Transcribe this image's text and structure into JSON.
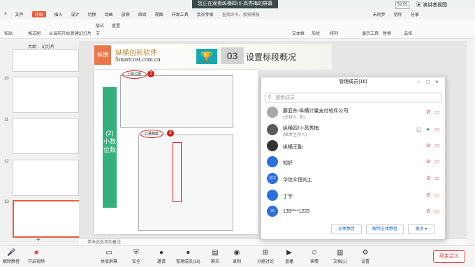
{
  "share_banner": "您正在观看纵横四川-高秀梅的屏幕",
  "clock": "59:55",
  "presenter_label": "演讲者视图",
  "menu": {
    "file": "文件",
    "items": [
      "开始",
      "插入",
      "设计",
      "切换",
      "动画",
      "放映",
      "审阅",
      "视图",
      "开发工具",
      "会员专享"
    ],
    "search": "查找命令、搜索模板",
    "right": [
      "未同步",
      "协作",
      "分享"
    ]
  },
  "ribbon": {
    "paste": "粘贴",
    "format": "格式刷",
    "from_start": "从当前开始",
    "new_slide": "新建幻灯片",
    "layout": "版式",
    "section": "节",
    "reset": "重置",
    "textbox": "文本框",
    "shape": "形状",
    "arrange": "排列",
    "tools": "演示工具",
    "replace": "替换",
    "select": "选择"
  },
  "thumbs_tabs": {
    "outline": "大纲",
    "slides": "幻灯片"
  },
  "thumb_numbers": [
    "10",
    "11",
    "12",
    "13"
  ],
  "slide": {
    "logo": "纵横",
    "brand": "纵横创新软件",
    "url": "Smartcost.com.cn",
    "section_num": "03",
    "section_title": "设置标段概况",
    "side_label": "(2) 小数位数",
    "oval1": "小数位数",
    "oval2": "计量精度",
    "badge1": "1",
    "badge2": "2"
  },
  "notes": "单击此处添加备注",
  "panel": {
    "title": "管理成员(16)",
    "search_placeholder": "搜索成员",
    "members": [
      {
        "name": "藤亚东-纵横计量支付软件公司",
        "role": "(主持人, 我)",
        "avatar": "",
        "avatar_color": "#a7a7a7"
      },
      {
        "name": "纵横四川-高秀梅",
        "role": "(联席主持人)",
        "avatar": "",
        "avatar_color": "#5a5a5a"
      },
      {
        "name": "纵横王勤",
        "role": "",
        "avatar": "",
        "avatar_color": "#333333"
      },
      {
        "name": "知好",
        "role": "",
        "avatar": "",
        "avatar_color": "#2b6fe0"
      },
      {
        "name": "华信众恒刘工",
        "role": "",
        "avatar": "刘工",
        "avatar_color": "#2b6fe0"
      },
      {
        "name": "丁宇",
        "role": "",
        "avatar": "",
        "avatar_color": "#2b6fe0"
      },
      {
        "name": "139****1229",
        "role": "",
        "avatar": "29",
        "avatar_color": "#2b6fe0"
      }
    ],
    "buttons": [
      "全体静音",
      "解除全体静音",
      "更多"
    ]
  },
  "toolbar": {
    "items": [
      "解除静音",
      "开启视频",
      "共享屏幕",
      "安全",
      "邀请",
      "管理成员(16)",
      "聊天",
      "录制",
      "分组讨论",
      "直播",
      "表情",
      "文档(1)",
      "设置"
    ],
    "end": "结束会议"
  }
}
